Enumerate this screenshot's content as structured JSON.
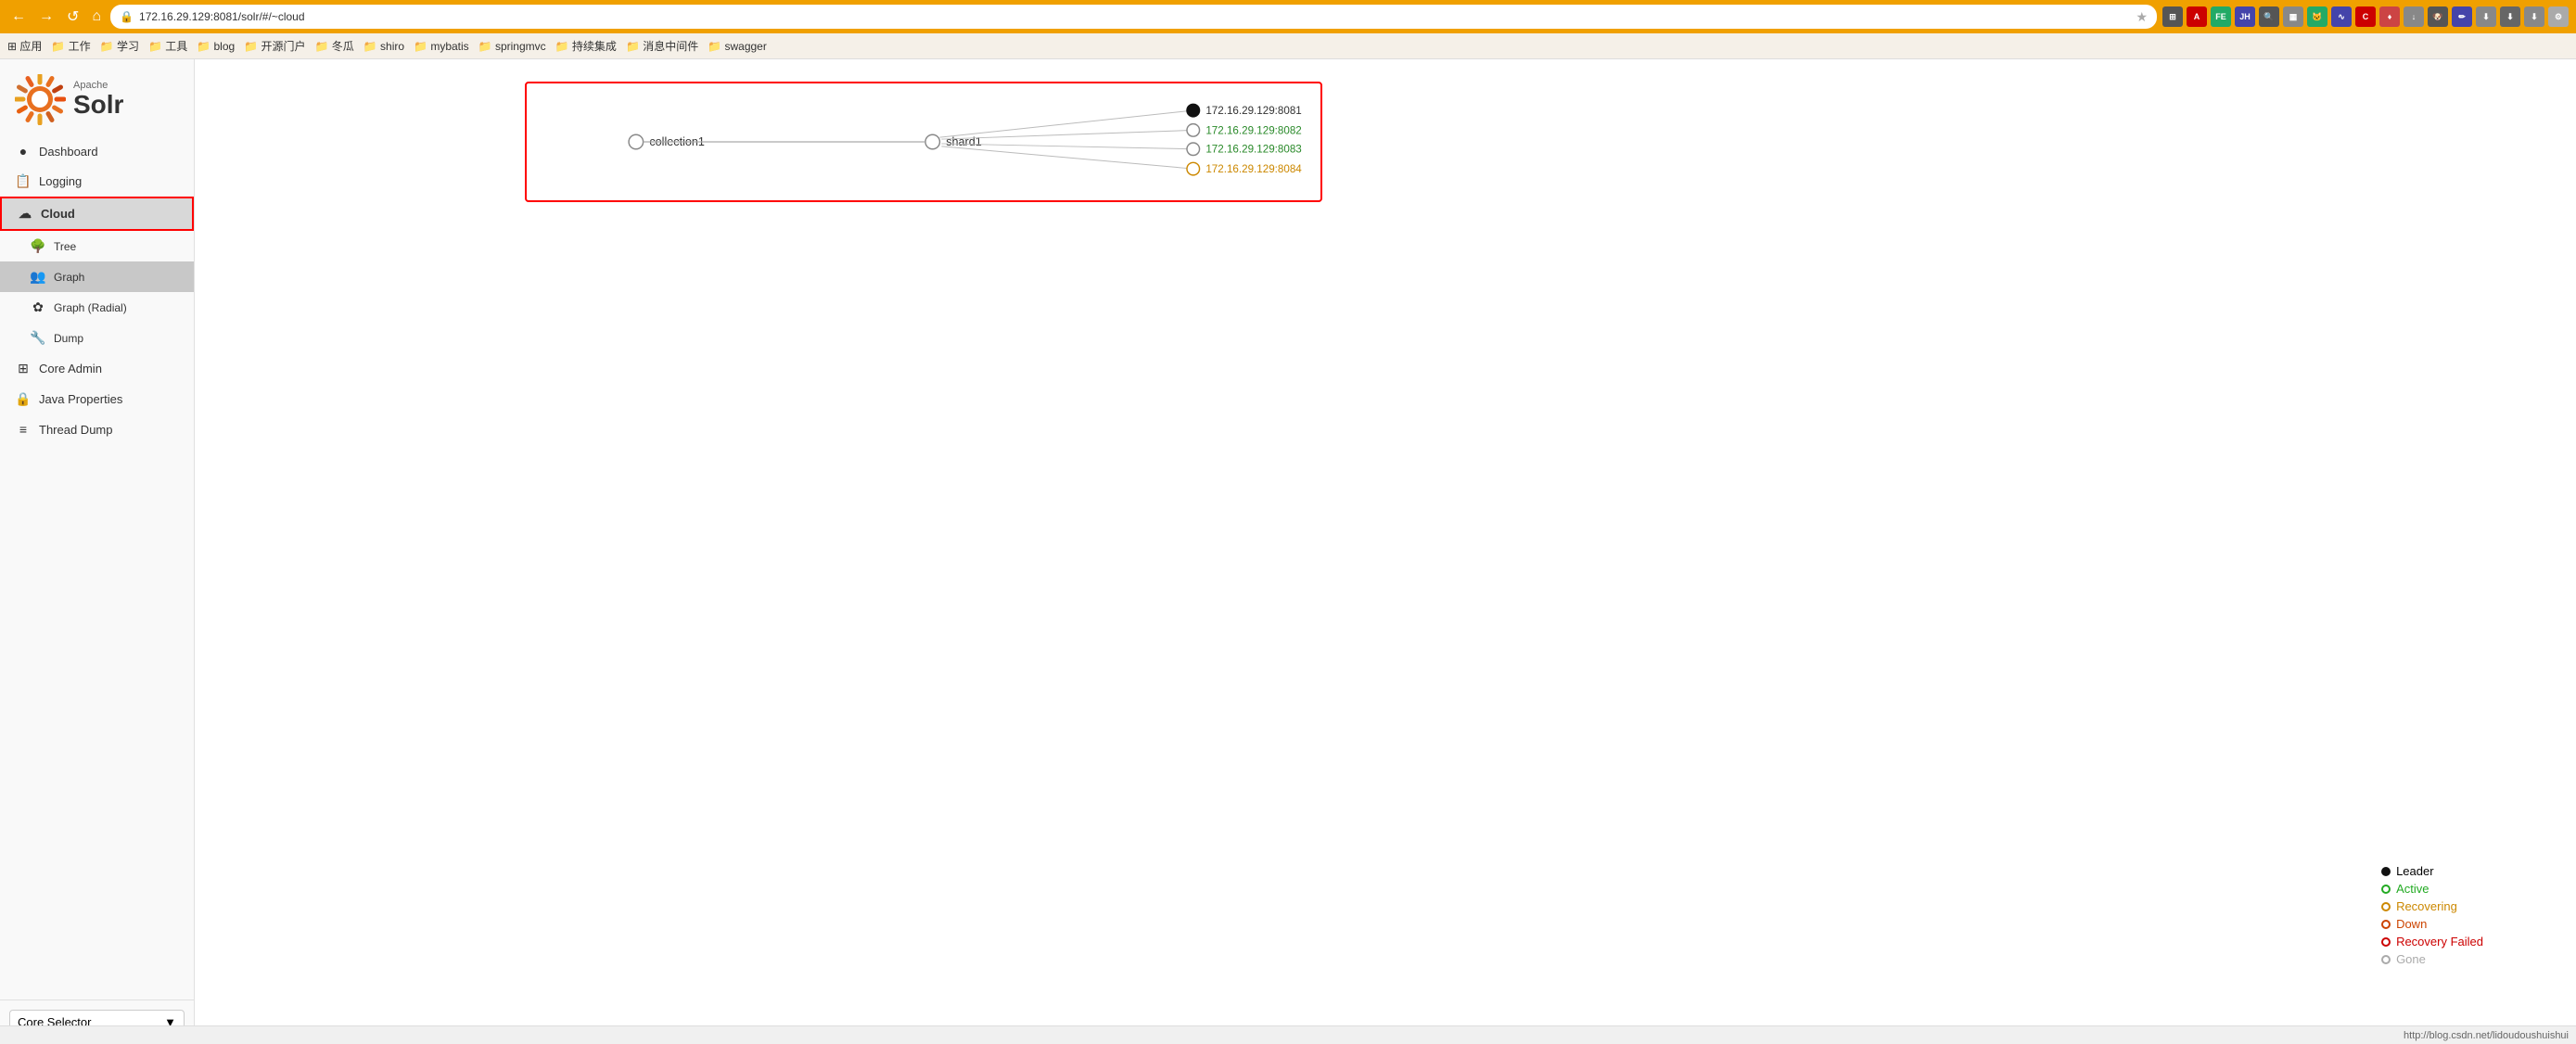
{
  "browser": {
    "url": "172.16.29.129:8081/solr/#/~cloud",
    "back_btn": "←",
    "forward_btn": "→",
    "reload_btn": "↺",
    "home_btn": "⌂"
  },
  "bookmarks": [
    {
      "label": "应用",
      "icon": "⊞"
    },
    {
      "label": "工作",
      "icon": "📁"
    },
    {
      "label": "学习",
      "icon": "📁"
    },
    {
      "label": "工具",
      "icon": "📁"
    },
    {
      "label": "blog",
      "icon": "📁"
    },
    {
      "label": "开源门户",
      "icon": "📁"
    },
    {
      "label": "冬瓜",
      "icon": "📁"
    },
    {
      "label": "shiro",
      "icon": "📁"
    },
    {
      "label": "mybatis",
      "icon": "📁"
    },
    {
      "label": "springmvc",
      "icon": "📁"
    },
    {
      "label": "持续集成",
      "icon": "📁"
    },
    {
      "label": "消息中间件",
      "icon": "📁"
    },
    {
      "label": "swagger",
      "icon": "📁"
    }
  ],
  "sidebar": {
    "apache_label": "Apache",
    "solr_label": "Solr",
    "nav_items": [
      {
        "id": "dashboard",
        "label": "Dashboard",
        "icon": "●"
      },
      {
        "id": "logging",
        "label": "Logging",
        "icon": "📋"
      },
      {
        "id": "cloud",
        "label": "Cloud",
        "icon": "☁",
        "active": true
      },
      {
        "id": "tree",
        "label": "Tree",
        "icon": "🌳",
        "sub": true
      },
      {
        "id": "graph",
        "label": "Graph",
        "icon": "👥",
        "sub": true,
        "sub_active": true
      },
      {
        "id": "graph-radial",
        "label": "Graph (Radial)",
        "icon": "✿",
        "sub": true
      },
      {
        "id": "dump",
        "label": "Dump",
        "icon": "🔧",
        "sub": true
      },
      {
        "id": "core-admin",
        "label": "Core Admin",
        "icon": "⊞"
      },
      {
        "id": "java-properties",
        "label": "Java Properties",
        "icon": "🔒"
      },
      {
        "id": "thread-dump",
        "label": "Thread Dump",
        "icon": "≡"
      }
    ],
    "core_selector_label": "Core Selector",
    "core_selector_arrow": "▼"
  },
  "graph": {
    "node_collection": "collection1",
    "node_shard": "shard1",
    "nodes": [
      {
        "id": "n1",
        "label": "172.16.29.129:8081",
        "type": "leader",
        "color": "#111"
      },
      {
        "id": "n2",
        "label": "172.16.29.129:8082",
        "type": "active",
        "color": "#2a2"
      },
      {
        "id": "n3",
        "label": "172.16.29.129:8083",
        "type": "active",
        "color": "#2a2"
      },
      {
        "id": "n4",
        "label": "172.16.29.129:8084",
        "type": "recovering",
        "color": "#cc8800"
      }
    ]
  },
  "legend": {
    "items": [
      {
        "id": "leader",
        "label": "Leader",
        "type": "leader"
      },
      {
        "id": "active",
        "label": "Active",
        "type": "active"
      },
      {
        "id": "recovering",
        "label": "Recovering",
        "type": "recovering"
      },
      {
        "id": "down",
        "label": "Down",
        "type": "down"
      },
      {
        "id": "recovery-failed",
        "label": "Recovery Failed",
        "type": "recovery-failed"
      },
      {
        "id": "gone",
        "label": "Gone",
        "type": "gone"
      }
    ]
  },
  "status_bar": {
    "url": "http://blog.csdn.net/lidoudoushuishui"
  }
}
